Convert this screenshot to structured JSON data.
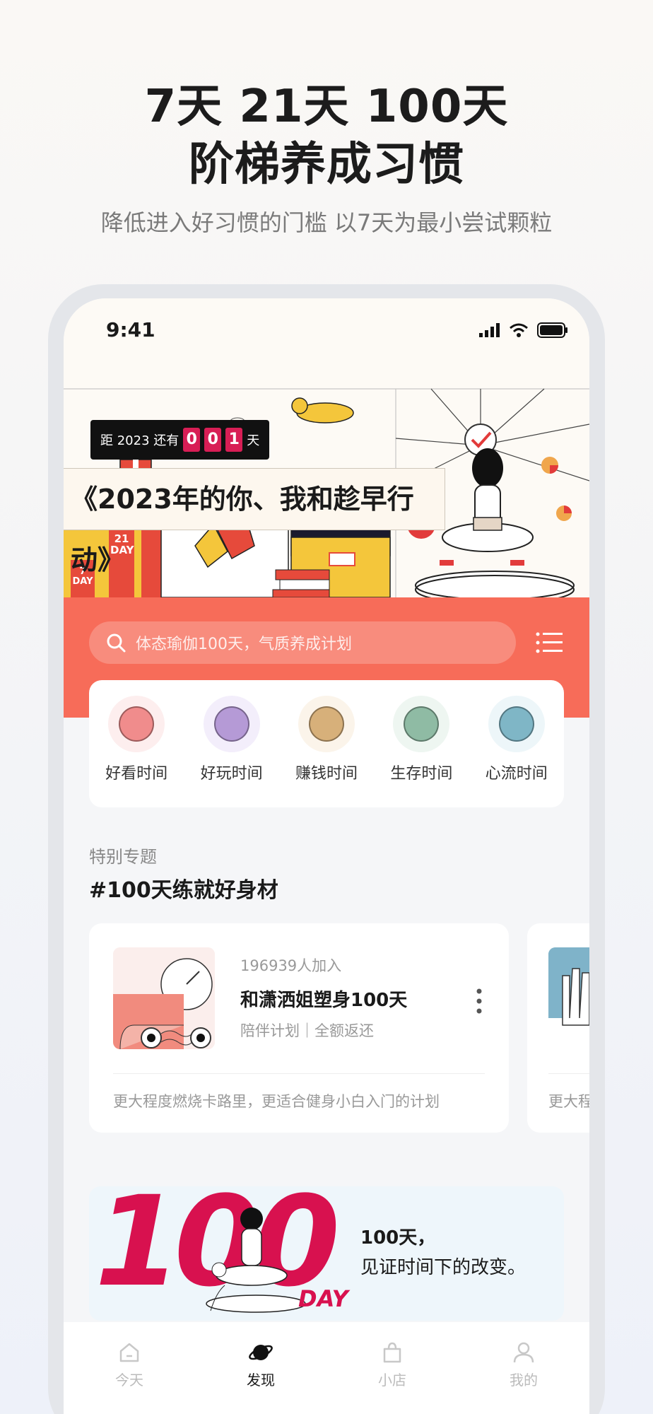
{
  "hero": {
    "title_line1": "7天 21天 100天",
    "title_line2": "阶梯养成习惯",
    "subtitle": "降低进入好习惯的门槛 以7天为最小尝试颗粒"
  },
  "status_bar": {
    "time": "9:41"
  },
  "banner": {
    "countdown_prefix": "距 2023 还有",
    "countdown_digits": [
      "0",
      "0",
      "1"
    ],
    "countdown_suffix": "天",
    "title": "《2023年的你、我和趁早行动》",
    "tags": [
      "7 DAY",
      "21 DAY",
      "100 DAY"
    ]
  },
  "search": {
    "placeholder": "体态瑜伽100天，气质养成计划"
  },
  "categories": [
    {
      "label": "好看时间",
      "color": "#f08c8c",
      "bg": "#fdeeee"
    },
    {
      "label": "好玩时间",
      "color": "#b59ad6",
      "bg": "#f3eefb"
    },
    {
      "label": "赚钱时间",
      "color": "#d7b07a",
      "bg": "#fbf4ea"
    },
    {
      "label": "生存时间",
      "color": "#8fbba4",
      "bg": "#eef6f1"
    },
    {
      "label": "心流时间",
      "color": "#7fb6c6",
      "bg": "#edf6f9"
    }
  ],
  "special": {
    "label": "特别专题",
    "title": "#100天练就好身材"
  },
  "plan_card": {
    "joined": "196939人加入",
    "title": "和潇洒姐塑身100天",
    "tags": "陪伴计划｜全额返还",
    "desc": "更大程度燃烧卡路里，更适合健身小白入门的计划"
  },
  "plan_card2": {
    "desc": "更大程"
  },
  "promo": {
    "number": "100",
    "day": "DAY",
    "line1": "100天，",
    "line2": "见证时间下的改变。"
  },
  "tabbar": [
    {
      "label": "今天",
      "icon": "home-icon",
      "active": false
    },
    {
      "label": "发现",
      "icon": "planet-icon",
      "active": true
    },
    {
      "label": "小店",
      "icon": "bag-icon",
      "active": false
    },
    {
      "label": "我的",
      "icon": "user-icon",
      "active": false
    }
  ],
  "colors": {
    "coral": "#f76c59",
    "accent": "#d8114f"
  }
}
